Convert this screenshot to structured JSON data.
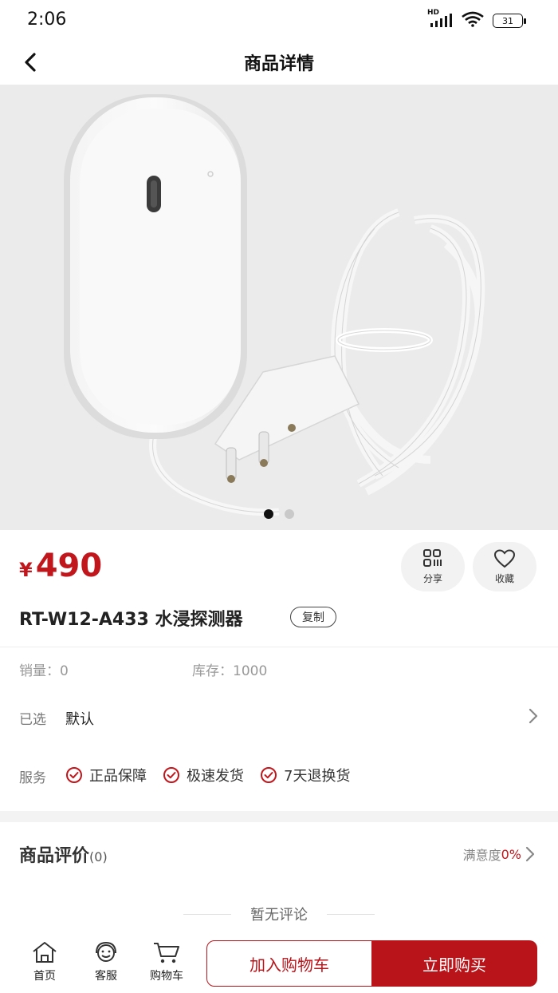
{
  "status_bar": {
    "time": "2:06",
    "network": "HD",
    "battery": "31"
  },
  "nav": {
    "title": "商品详情"
  },
  "gallery": {
    "image_count": 2,
    "active_index": 0
  },
  "product": {
    "currency": "¥",
    "price": "490",
    "title": "RT-W12-A433 水浸探测器",
    "copy_label": "复制"
  },
  "actions": {
    "share_label": "分享",
    "favorite_label": "收藏"
  },
  "meta": {
    "sales": "销量：0",
    "stock": "库存：1000"
  },
  "selection": {
    "label": "已选",
    "value": "默认"
  },
  "service": {
    "label": "服务",
    "items": [
      "正品保障",
      "极速发货",
      "7天退换货"
    ]
  },
  "reviews": {
    "title": "商品评价",
    "count": "(0)",
    "satisfaction_label": "满意度",
    "satisfaction_value": "0%",
    "empty_text": "暂无评论"
  },
  "bottom_bar": {
    "home": "首页",
    "service": "客服",
    "cart": "购物车",
    "add_to_cart": "加入购物车",
    "buy_now": "立即购买"
  },
  "colors": {
    "accent": "#b8141a",
    "price": "#c0161c"
  }
}
